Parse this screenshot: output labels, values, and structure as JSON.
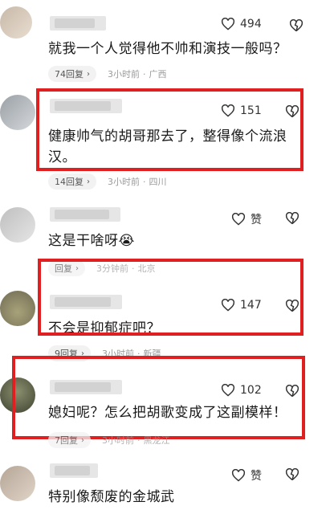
{
  "comments": [
    {
      "text": "就我一个人觉得他不帅和演技一般吗？",
      "likes": "494",
      "replies": "74回复",
      "time": "3小时前",
      "location": "广西"
    },
    {
      "text_line1": "健康帅气的胡哥那去了，整得像个流浪",
      "text_line2": "汉。",
      "likes": "151",
      "replies": "14回复",
      "time": "3小时前",
      "location": "四川"
    },
    {
      "text": "这是干啥呀",
      "emoji": "😭",
      "likes": "赞",
      "replies": "回复",
      "time": "3分钟前",
      "location": "北京"
    },
    {
      "text": "不会是抑郁症吧？",
      "likes": "147",
      "replies": "9回复",
      "time": "3小时前",
      "location": "新疆"
    },
    {
      "text": "媳妇呢？怎么把胡歌变成了这副模样！",
      "likes": "102",
      "replies": "7回复",
      "time": "3小时前",
      "location": "黑龙江"
    },
    {
      "text": "特别像颓废的金城武",
      "likes": "赞"
    }
  ],
  "icons": {
    "like": "heart-outline-icon",
    "dislike": "broken-heart-icon",
    "reply_chevron": "chevron-right-icon"
  },
  "highlight_color": "#e02020",
  "symbols": {
    "chevron": "›",
    "dot": "·"
  }
}
